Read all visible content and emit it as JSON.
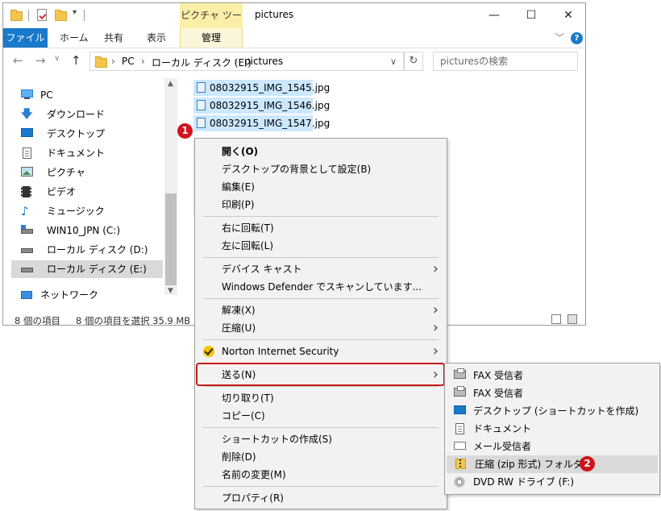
{
  "window": {
    "title": "pictures",
    "context_tab_header": "ピクチャ ツール",
    "controls": {
      "minimize": "—",
      "maximize": "☐",
      "close": "✕"
    }
  },
  "ribbon": {
    "tabs": [
      "ファイル",
      "ホーム",
      "共有",
      "表示"
    ],
    "context_tab": "管理",
    "help": "?"
  },
  "address": {
    "crumbs": [
      "PC",
      "ローカル ディスク (E:)",
      "pictures"
    ],
    "search_placeholder": "picturesの検索"
  },
  "nav_pane": {
    "items": [
      {
        "label": "PC",
        "icon": "pc-icon"
      },
      {
        "label": "ダウンロード",
        "icon": "download-icon"
      },
      {
        "label": "デスクトップ",
        "icon": "desktop-icon"
      },
      {
        "label": "ドキュメント",
        "icon": "document-icon"
      },
      {
        "label": "ピクチャ",
        "icon": "pictures-icon"
      },
      {
        "label": "ビデオ",
        "icon": "video-icon"
      },
      {
        "label": "ミュージック",
        "icon": "music-icon"
      },
      {
        "label": "WIN10_JPN (C:)",
        "icon": "system-drive-icon"
      },
      {
        "label": "ローカル ディスク (D:)",
        "icon": "drive-icon"
      },
      {
        "label": "ローカル ディスク (E:)",
        "icon": "drive-icon",
        "selected": true
      },
      {
        "label": "ネットワーク",
        "icon": "network-icon"
      }
    ]
  },
  "files": [
    "08032915_IMG_1545.jpg",
    "08032915_IMG_1546.jpg",
    "08032915_IMG_1547.jpg"
  ],
  "status": {
    "item_count": "8 個の項目",
    "selection": "8 個の項目を選択  35.9 MB"
  },
  "context_menu": {
    "groups": [
      [
        {
          "label": "開く(O)",
          "bold": true
        },
        {
          "label": "デスクトップの背景として設定(B)"
        },
        {
          "label": "編集(E)"
        },
        {
          "label": "印刷(P)"
        }
      ],
      [
        {
          "label": "右に回転(T)"
        },
        {
          "label": "左に回転(L)"
        }
      ],
      [
        {
          "label": "デバイス キャスト",
          "submenu": true
        },
        {
          "label": "Windows Defender でスキャンしています..."
        }
      ],
      [
        {
          "label": "解凍(X)",
          "submenu": true
        },
        {
          "label": "圧縮(U)",
          "submenu": true
        }
      ],
      [
        {
          "label": "Norton Internet Security",
          "submenu": true,
          "icon": "norton-check-icon"
        }
      ],
      [
        {
          "label": "送る(N)",
          "submenu": true,
          "highlighted": true
        }
      ],
      [
        {
          "label": "切り取り(T)"
        },
        {
          "label": "コピー(C)"
        }
      ],
      [
        {
          "label": "ショートカットの作成(S)"
        },
        {
          "label": "削除(D)"
        },
        {
          "label": "名前の変更(M)"
        }
      ],
      [
        {
          "label": "プロパティ(R)"
        }
      ]
    ]
  },
  "send_to_menu": {
    "items": [
      {
        "label": "FAX 受信者",
        "icon": "fax-icon"
      },
      {
        "label": "FAX 受信者",
        "icon": "fax-icon"
      },
      {
        "label": "デスクトップ (ショートカットを作成)",
        "icon": "desktop-icon"
      },
      {
        "label": "ドキュメント",
        "icon": "document-icon"
      },
      {
        "label": "メール受信者",
        "icon": "mail-icon"
      },
      {
        "label": "圧縮 (zip 形式) フォルダー",
        "icon": "zip-folder-icon",
        "hover": true
      },
      {
        "label": "DVD RW ドライブ (F:)",
        "icon": "dvd-drive-icon"
      }
    ]
  },
  "annotations": {
    "step1": "1",
    "step2": "2"
  },
  "colors": {
    "accent": "#1979ca",
    "selection": "#cce8ff",
    "highlight_border": "#c91919",
    "badge": "#d1141c",
    "context_tab": "#fbefa8"
  }
}
